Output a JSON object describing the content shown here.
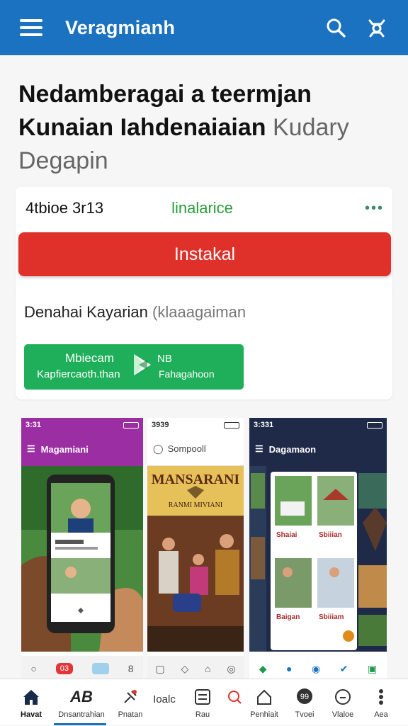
{
  "appbar": {
    "title": "Veragmianh",
    "menu_icon": "menu-icon",
    "search_icon": "search-icon",
    "profile_icon": "profile-icon",
    "color": "#1b72c0"
  },
  "headline": {
    "bold": "Nedamberagai a teermjan Kunaian Iahdenaiaian",
    "light": "Kudary Degapin"
  },
  "meta": {
    "size": "4tbioe 3r13",
    "status": "linalarice",
    "more_icon": "more-dots-icon"
  },
  "install": {
    "label": "Instakal",
    "color": "#e0302a"
  },
  "description": {
    "text": "Denahai Kayarian",
    "muted": "(klaaagaiman"
  },
  "play_badge": {
    "line1": "Mbiecam",
    "line2": "Kapfiercaoth.than",
    "right1": "NB",
    "right2": "Fahagahoon",
    "icon": "play-store-icon",
    "color": "#1fae59"
  },
  "screenshots": [
    {
      "time": "3:31",
      "header": "Magamiani",
      "nav": [
        "Q",
        "03",
        "",
        "8"
      ]
    },
    {
      "time": "3939",
      "header": "Sompooll",
      "banner": "MANSARANI",
      "sub": "RANMI MIVIANI"
    },
    {
      "time": "3:331",
      "header": "Dagamaon",
      "cards": [
        "Shaiai",
        "Sbiiian",
        "Baigan",
        "Sbiiiam"
      ]
    }
  ],
  "bottom_nav": [
    {
      "label": "Havat",
      "icon": "home-icon",
      "active": true
    },
    {
      "label": "Dnsantrahian",
      "icon": "ab-icon",
      "active": false
    },
    {
      "label": "Pnatan",
      "icon": "pin-icon",
      "active": false
    },
    {
      "label": "Ioalc",
      "icon": "text-icon",
      "active": false
    },
    {
      "label": "Rau",
      "icon": "grid-icon",
      "active": false
    },
    {
      "label": "",
      "icon": "search-circle-icon",
      "active": false
    },
    {
      "label": "Penhiait",
      "icon": "house-outline-icon",
      "active": false
    },
    {
      "label": "Tvoei",
      "icon": "chat-icon",
      "active": false
    },
    {
      "label": "Vlaloe",
      "icon": "circle-icon",
      "active": false
    },
    {
      "label": "Aea",
      "icon": "more-vert-icon",
      "active": false
    }
  ]
}
